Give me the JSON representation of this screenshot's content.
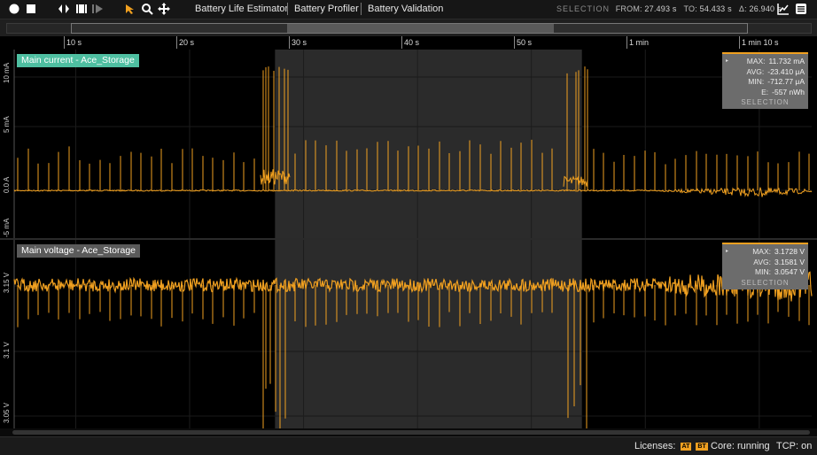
{
  "toolbar": {
    "tools": [
      "Battery Life Estimator",
      "Battery Profiler",
      "Battery Validation"
    ],
    "selection_label": "SELECTION",
    "from_label": "FROM:",
    "from_value": "27.493 s",
    "to_label": "TO:",
    "to_value": "54.433 s",
    "delta_label": "Δ:",
    "delta_value": "26.940 s"
  },
  "time_axis": {
    "unit": "s",
    "visible_range_s": [
      4.6,
      74.6
    ],
    "ticks": [
      "10 s",
      "20 s",
      "30 s",
      "40 s",
      "50 s",
      "1 min",
      "1 min 10 s"
    ]
  },
  "selection": {
    "from_s": 27.493,
    "to_s": 54.433
  },
  "plots": {
    "current": {
      "label": "Main current - Ace_Storage",
      "label_color": "#4ebfa1",
      "y_ticks": [
        "10 mA",
        "5 mA",
        "0.0 A",
        "-5 mA"
      ],
      "stats": {
        "max_label": "MAX:",
        "max": "11.732 mA",
        "avg_label": "AVG:",
        "avg": "-23.410 μA",
        "min_label": "MIN:",
        "min": "-712.77 μA",
        "e_label": "E:",
        "e": "-557 nWh",
        "footer": "SELECTION"
      }
    },
    "voltage": {
      "label": "Main voltage - Ace_Storage",
      "label_color": "#5a5a5a",
      "y_ticks": [
        "3.15 V",
        "3.1 V",
        "3.05 V"
      ],
      "stats": {
        "max_label": "MAX:",
        "max": "3.1728 V",
        "avg_label": "AVG:",
        "avg": "3.1581 V",
        "min_label": "MIN:",
        "min": "3.0547 V",
        "footer": "SELECTION"
      }
    }
  },
  "trace_color": "#f0a020",
  "statusbar": {
    "licenses_label": "Licenses:",
    "license_badges": [
      "AT",
      "BT"
    ],
    "core": "Core: running",
    "tcp": "TCP: on"
  }
}
